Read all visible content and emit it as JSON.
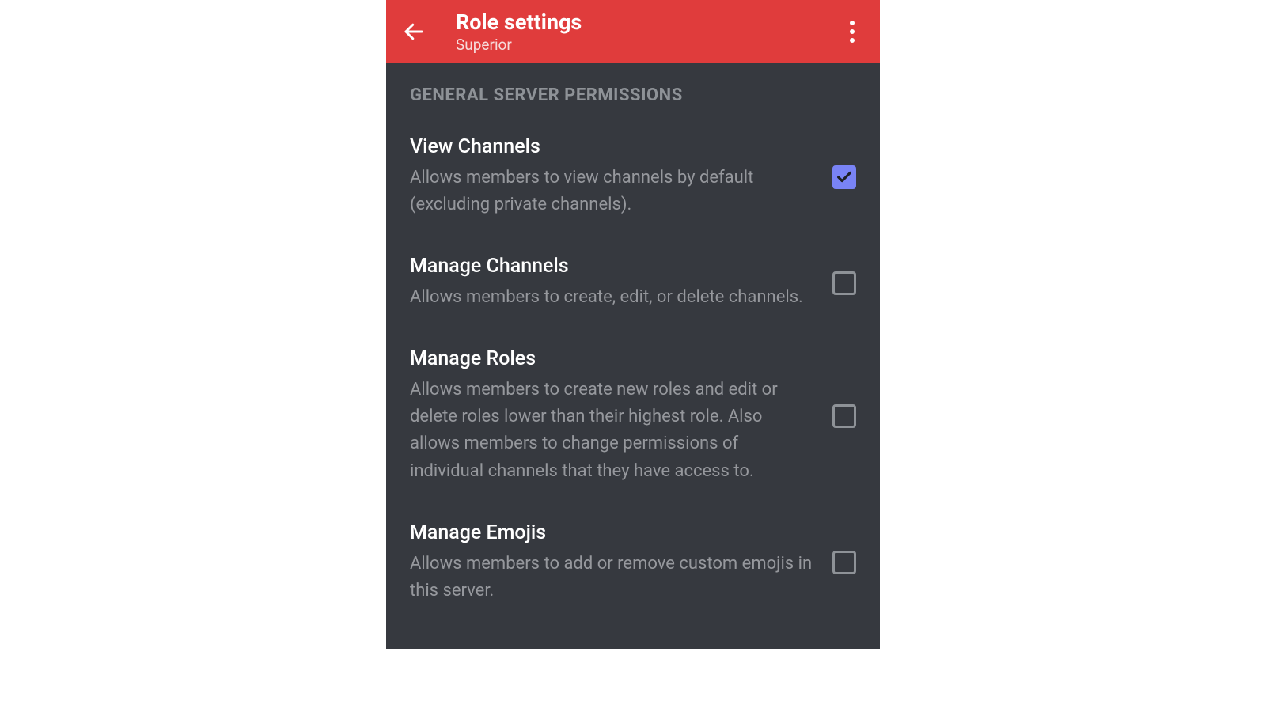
{
  "header": {
    "title": "Role settings",
    "subtitle": "Superior"
  },
  "section": {
    "header": "GENERAL SERVER PERMISSIONS"
  },
  "permissions": [
    {
      "title": "View Channels",
      "description": "Allows members to view channels by default (excluding private channels).",
      "checked": true
    },
    {
      "title": "Manage Channels",
      "description": "Allows members to create, edit, or delete channels.",
      "checked": false
    },
    {
      "title": "Manage Roles",
      "description": "Allows members to create new roles and edit or delete roles lower than their highest role. Also allows members to change permissions of individual channels that they have access to.",
      "checked": false
    },
    {
      "title": "Manage Emojis",
      "description": "Allows members to add or remove custom emojis in this server.",
      "checked": false
    }
  ]
}
